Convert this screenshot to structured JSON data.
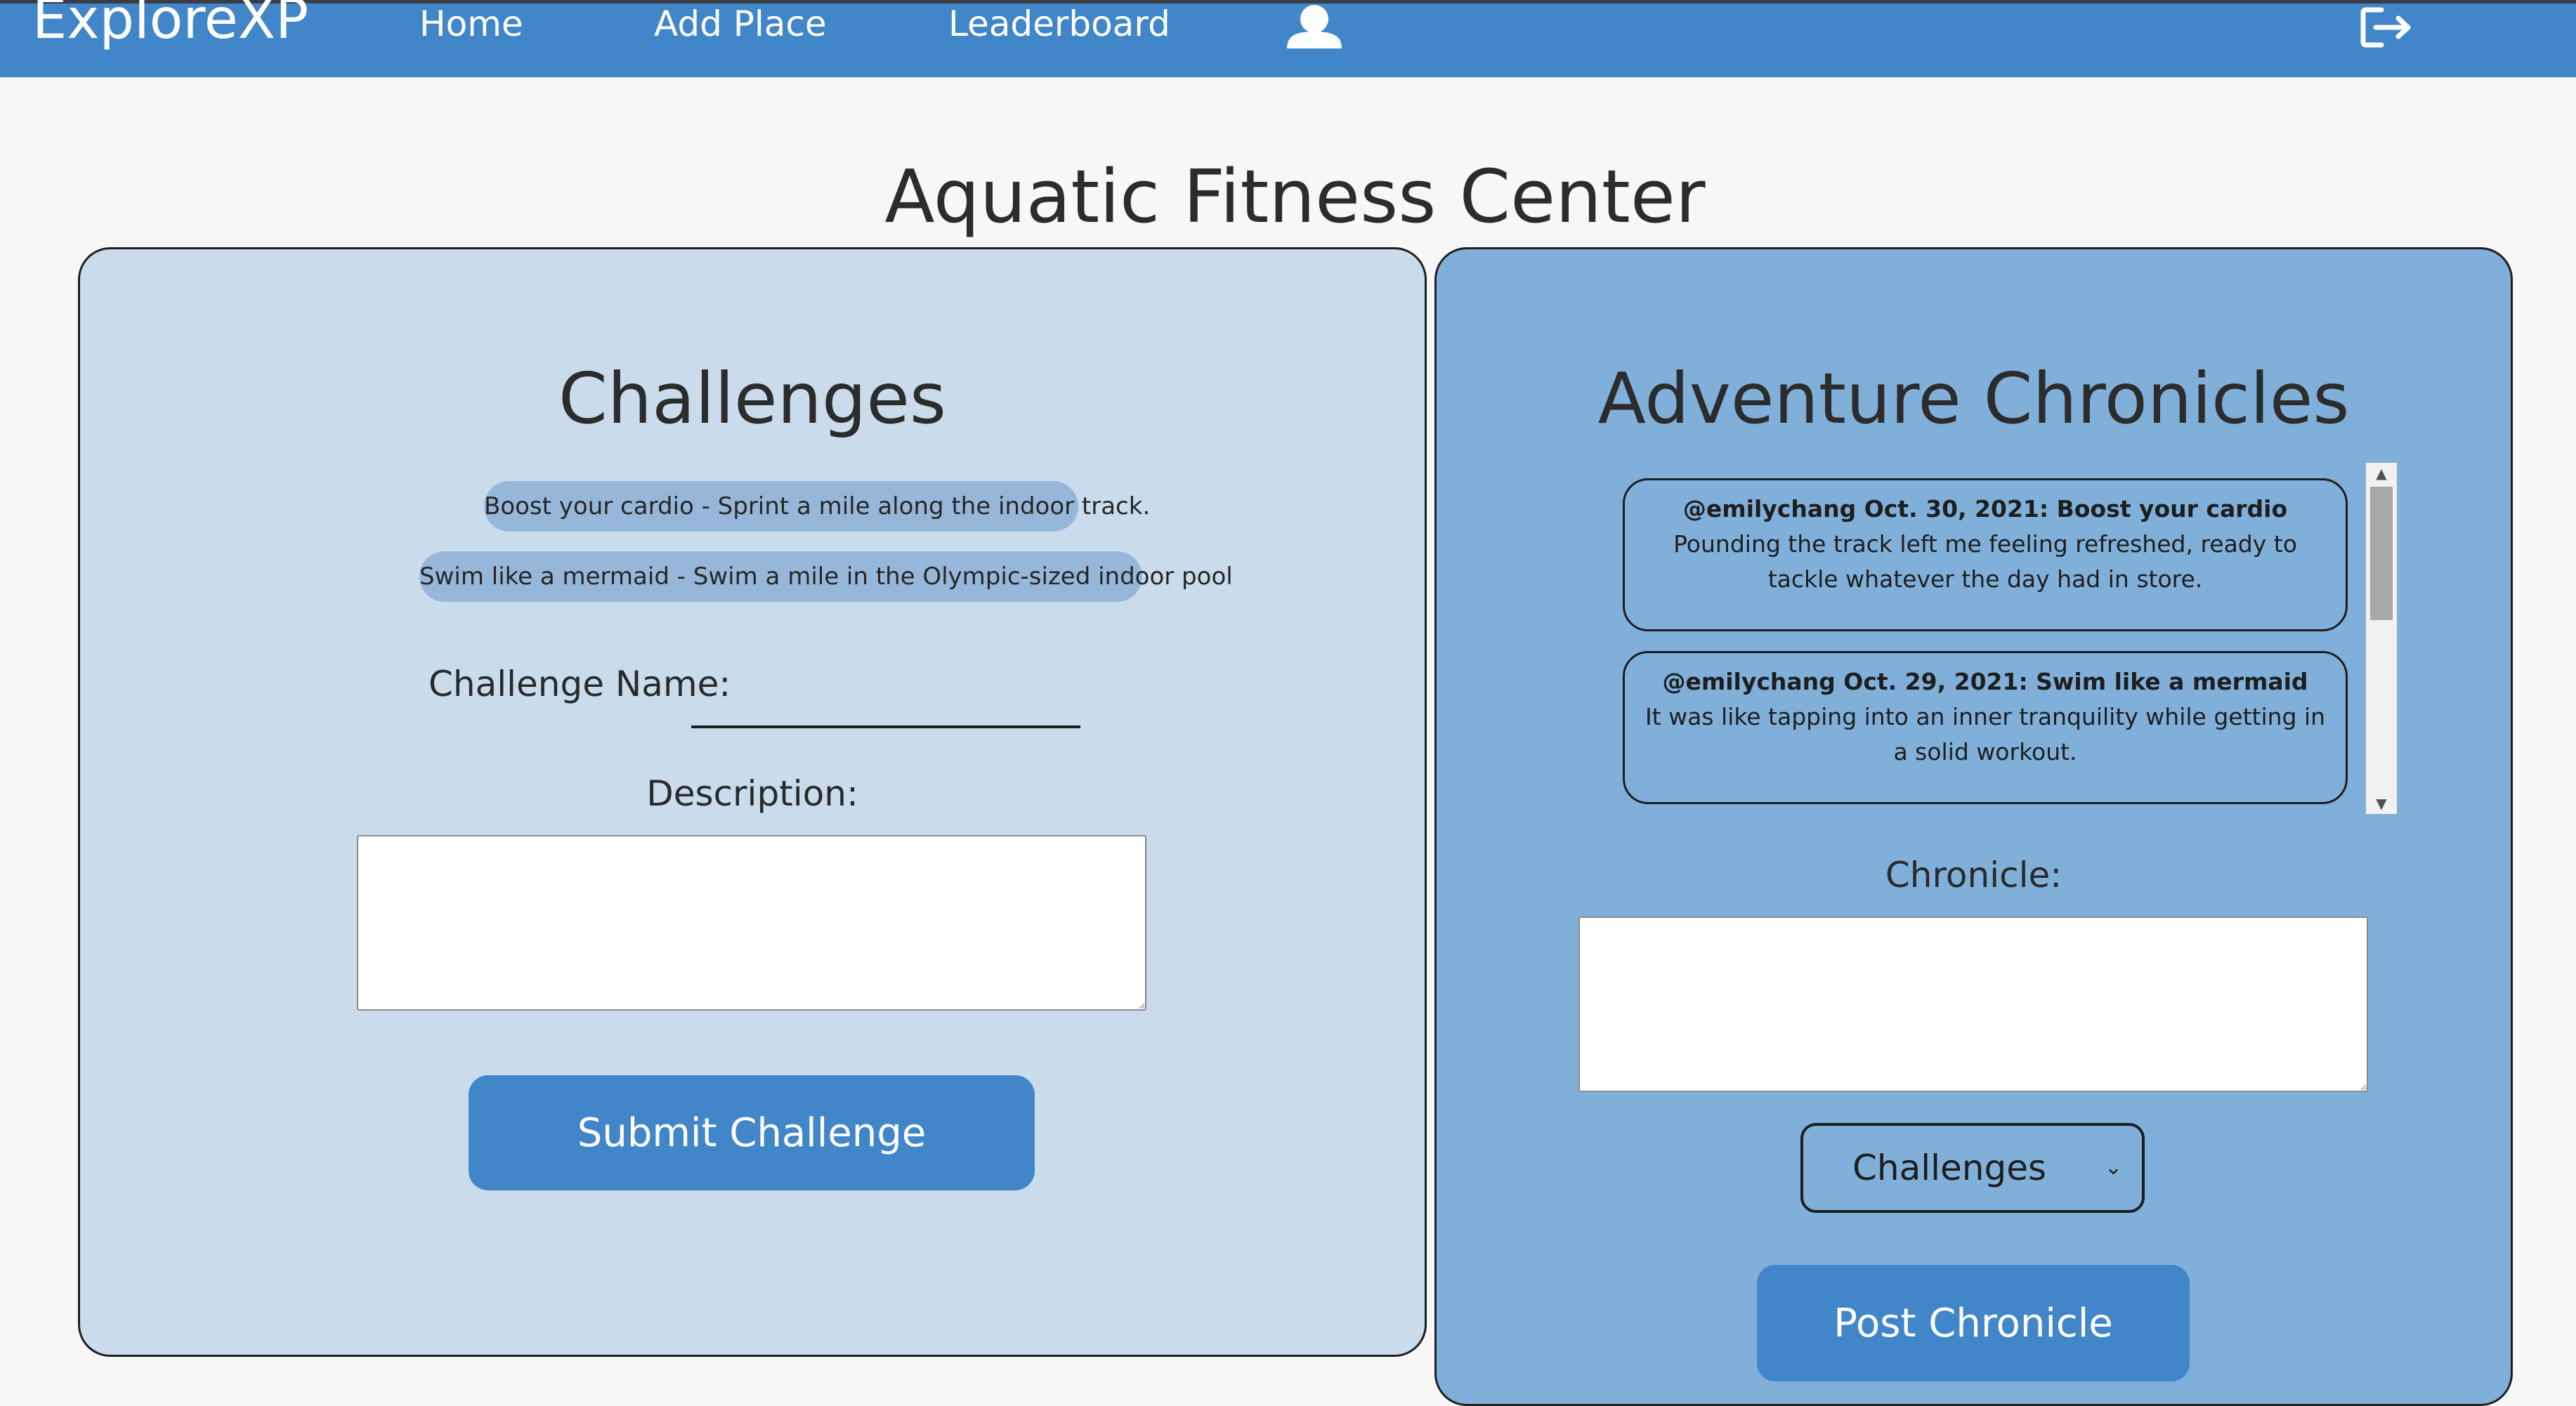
{
  "nav": {
    "brand": "ExploreXP",
    "links": [
      "Home",
      "Add Place",
      "Leaderboard"
    ],
    "user_icon": "user-icon",
    "logout_icon": "logout-icon"
  },
  "page": {
    "title": "Aquatic Fitness Center"
  },
  "challenges": {
    "heading": "Challenges",
    "items": [
      "Boost your cardio - Sprint a mile along the indoor track.",
      "Swim like a mermaid - Swim a mile in the Olympic-sized indoor pool"
    ],
    "name_label": "Challenge Name:",
    "name_value": "",
    "description_label": "Description:",
    "description_value": "",
    "submit_label": "Submit Challenge"
  },
  "chronicles": {
    "heading": "Adventure Chronicles",
    "entries": [
      {
        "title": "@emilychang Oct. 30, 2021: Boost your cardio",
        "body": "Pounding the track left me feeling refreshed, ready to tackle whatever the day had in store."
      },
      {
        "title": "@emilychang Oct. 29, 2021: Swim like a mermaid",
        "body": "It was like tapping into an inner tranquility while getting in a solid workout."
      }
    ],
    "chronicle_label": "Chronicle:",
    "chronicle_value": "",
    "select_value": "Challenges",
    "post_label": "Post Chronicle"
  },
  "colors": {
    "nav": "#4186c8",
    "left_panel": "#cadcec",
    "right_panel": "#80b0da",
    "pill": "#97b7da",
    "button": "#4186c8"
  }
}
